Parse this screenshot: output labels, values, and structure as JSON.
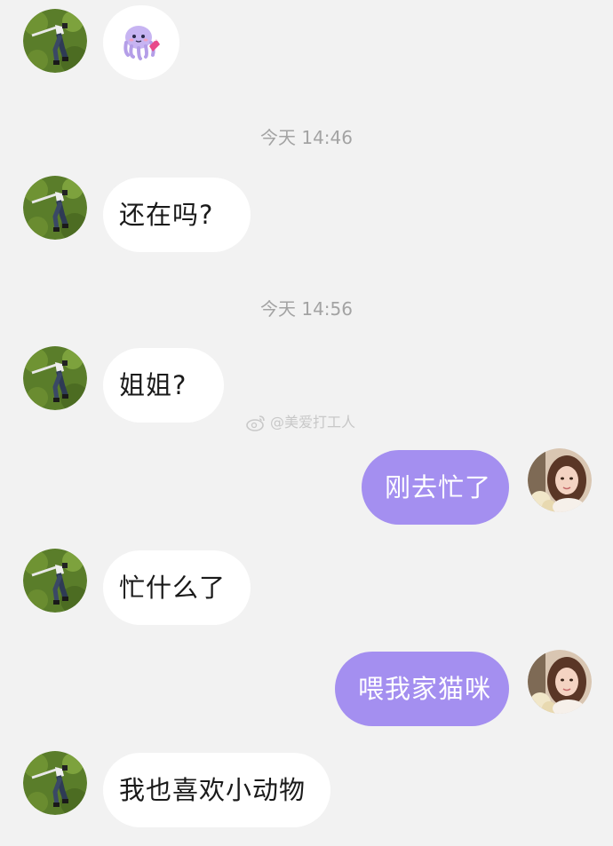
{
  "messages": [
    {
      "side": "in",
      "sticker": "purple-octopus-sticker",
      "text": ""
    },
    {
      "side": "in",
      "text": "还在吗?"
    },
    {
      "side": "in",
      "text": "姐姐?"
    },
    {
      "side": "out",
      "text": "刚去忙了"
    },
    {
      "side": "in",
      "text": "忙什么了"
    },
    {
      "side": "out",
      "text": "喂我家猫咪"
    },
    {
      "side": "in",
      "text": "我也喜欢小动物"
    }
  ],
  "timestamps": [
    "今天 14:46",
    "今天 14:56"
  ],
  "watermark": {
    "icon": "weibo-logo-icon",
    "text": "@美爱打工人"
  },
  "colors": {
    "background": "#f2f2f2",
    "incoming_bubble": "#ffffff",
    "outgoing_bubble": "#a48ff0",
    "timestamp": "#a3a3a3"
  }
}
